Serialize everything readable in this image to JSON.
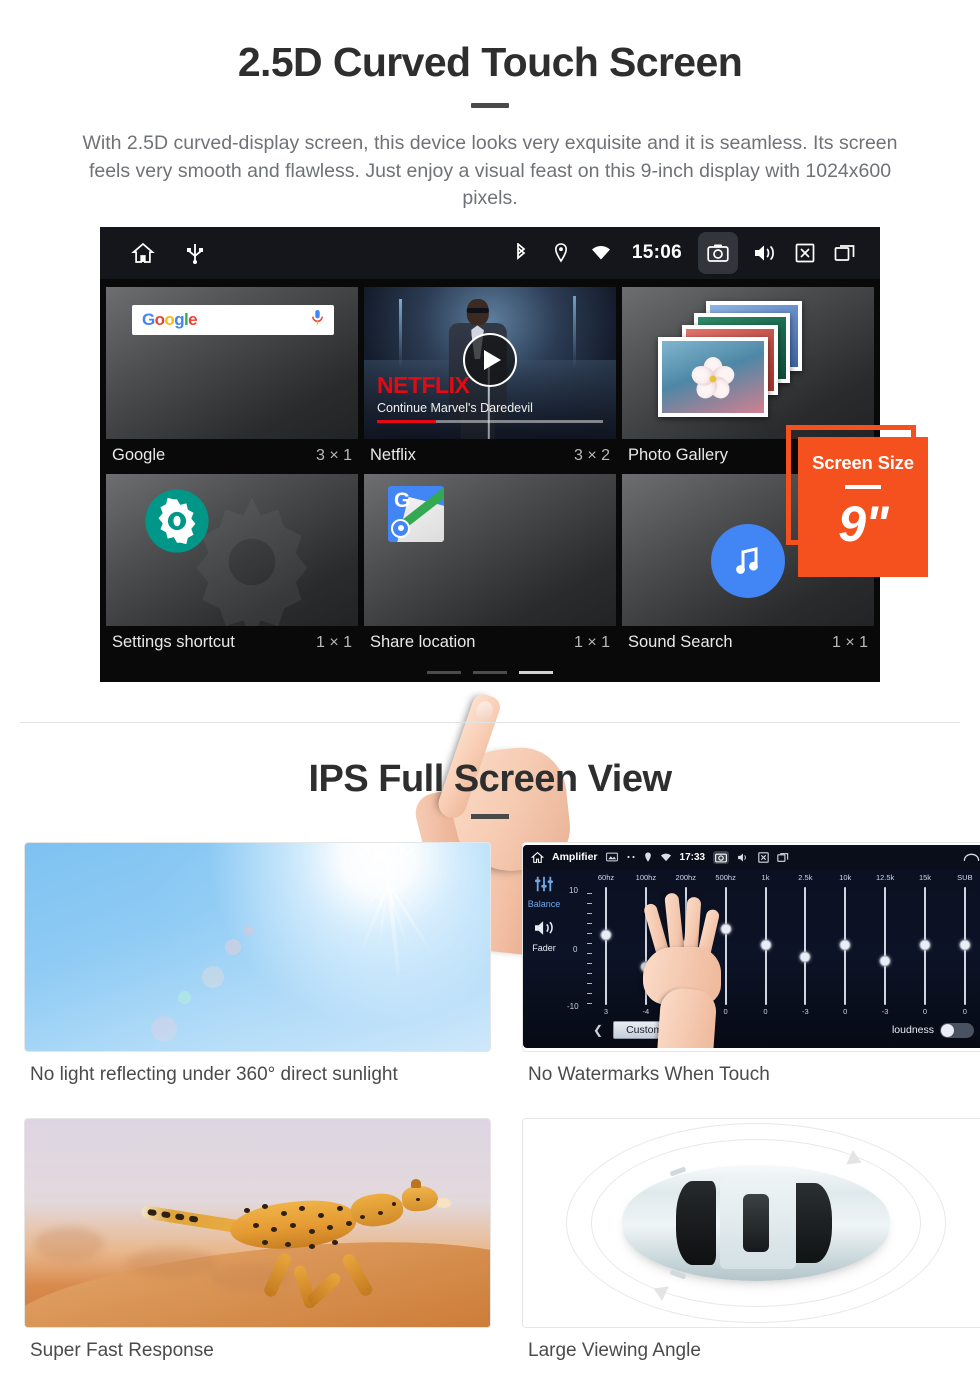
{
  "section1": {
    "title": "2.5D Curved Touch Screen",
    "description": "With 2.5D curved-display screen, this device looks very exquisite and it is seamless. Its screen feels very smooth and flawless. Just enjoy a visual feast on this 9-inch display with 1024x600 pixels."
  },
  "badge": {
    "title": "Screen Size",
    "value": "9\"",
    "color": "#F4511E"
  },
  "device": {
    "statusbar": {
      "time": "15:06",
      "left_icons": [
        "home-icon",
        "usb-icon"
      ],
      "right_icons": [
        "bluetooth-icon",
        "location-icon",
        "wifi-icon",
        "camera-icon",
        "volume-icon",
        "close-box-icon",
        "recents-icon"
      ]
    },
    "widgets": [
      {
        "name": "Google",
        "size": "3 × 1",
        "icon": "google-search-widget"
      },
      {
        "name": "Netflix",
        "size": "3 × 2",
        "icon": "netflix-widget"
      },
      {
        "name": "Photo Gallery",
        "size": "2 × 2",
        "icon": "photo-gallery-widget"
      },
      {
        "name": "Settings shortcut",
        "size": "1 × 1",
        "icon": "settings-gear-icon"
      },
      {
        "name": "Share location",
        "size": "1 × 1",
        "icon": "google-maps-icon"
      },
      {
        "name": "Sound Search",
        "size": "1 × 1",
        "icon": "sound-search-icon"
      }
    ],
    "netflix": {
      "brand": "NETFLIX",
      "subtitle": "Continue Marvel's Daredevil",
      "progress_percent": 26
    },
    "google_widget": {
      "logo_letters": [
        "G",
        "o",
        "o",
        "g",
        "l",
        "e"
      ],
      "logo_colors": [
        "#4285F4",
        "#EA4335",
        "#FBBC05",
        "#4285F4",
        "#34A853",
        "#EA4335"
      ]
    },
    "page_dots": {
      "count": 3,
      "active_index": 2
    }
  },
  "section2": {
    "title": "IPS Full Screen View",
    "cards": [
      {
        "caption": "No light reflecting under 360° direct sunlight",
        "image": "blue-sky-sun-flare"
      },
      {
        "caption": "No Watermarks When Touch",
        "image": "amplifier-equalizer-screenshot"
      },
      {
        "caption": "Super Fast Response",
        "image": "running-cheetah"
      },
      {
        "caption": "Large Viewing Angle",
        "image": "car-top-view-orbit"
      }
    ]
  },
  "amplifier": {
    "title": "Amplifier",
    "time": "17:33",
    "sidebar": [
      "Balance",
      "Fader"
    ],
    "scale_top": "10",
    "scale_mid": "0",
    "scale_bottom": "-10",
    "bands": [
      "60hz",
      "100hz",
      "200hz",
      "500hz",
      "1k",
      "2.5k",
      "10k",
      "12.5k",
      "15k",
      "SUB"
    ],
    "values": [
      "3",
      "-4",
      "0",
      "0",
      "0",
      "-3",
      "0",
      "-3",
      "0",
      "0"
    ],
    "preset_label": "Custom",
    "loudness_label": "loudness",
    "loudness_on": false
  }
}
